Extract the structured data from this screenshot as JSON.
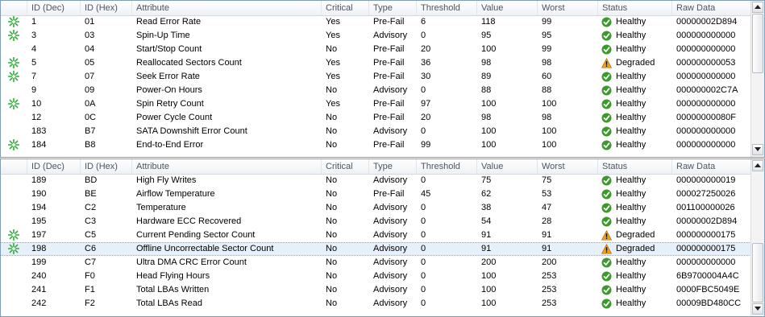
{
  "columns": [
    "",
    "ID (Dec)",
    "ID (Hex)",
    "Attribute",
    "Critical",
    "Type",
    "Threshold",
    "Value",
    "Worst",
    "Status",
    "Raw Data"
  ],
  "colors": {
    "healthy": "#3a9a2a",
    "degraded": "#f0a020",
    "critical_icon": "#2fae3a"
  },
  "top_rows": [
    {
      "crit_icon": true,
      "dec": "1",
      "hex": "01",
      "attr": "Read Error Rate",
      "critical": "Yes",
      "type": "Pre-Fail",
      "threshold": "6",
      "value": "118",
      "worst": "99",
      "status": "Healthy",
      "raw": "00000002D894"
    },
    {
      "crit_icon": true,
      "dec": "3",
      "hex": "03",
      "attr": "Spin-Up Time",
      "critical": "Yes",
      "type": "Advisory",
      "threshold": "0",
      "value": "95",
      "worst": "95",
      "status": "Healthy",
      "raw": "000000000000"
    },
    {
      "crit_icon": false,
      "dec": "4",
      "hex": "04",
      "attr": "Start/Stop Count",
      "critical": "No",
      "type": "Pre-Fail",
      "threshold": "20",
      "value": "100",
      "worst": "99",
      "status": "Healthy",
      "raw": "000000000000"
    },
    {
      "crit_icon": true,
      "dec": "5",
      "hex": "05",
      "attr": "Reallocated Sectors Count",
      "critical": "Yes",
      "type": "Pre-Fail",
      "threshold": "36",
      "value": "98",
      "worst": "98",
      "status": "Degraded",
      "raw": "000000000053"
    },
    {
      "crit_icon": true,
      "dec": "7",
      "hex": "07",
      "attr": "Seek Error Rate",
      "critical": "Yes",
      "type": "Pre-Fail",
      "threshold": "30",
      "value": "89",
      "worst": "60",
      "status": "Healthy",
      "raw": "000000000000"
    },
    {
      "crit_icon": false,
      "dec": "9",
      "hex": "09",
      "attr": "Power-On Hours",
      "critical": "No",
      "type": "Advisory",
      "threshold": "0",
      "value": "88",
      "worst": "88",
      "status": "Healthy",
      "raw": "000000002C7A"
    },
    {
      "crit_icon": true,
      "dec": "10",
      "hex": "0A",
      "attr": "Spin Retry Count",
      "critical": "Yes",
      "type": "Pre-Fail",
      "threshold": "97",
      "value": "100",
      "worst": "100",
      "status": "Healthy",
      "raw": "000000000000"
    },
    {
      "crit_icon": false,
      "dec": "12",
      "hex": "0C",
      "attr": "Power Cycle Count",
      "critical": "No",
      "type": "Pre-Fail",
      "threshold": "20",
      "value": "98",
      "worst": "98",
      "status": "Healthy",
      "raw": "00000000080F"
    },
    {
      "crit_icon": false,
      "dec": "183",
      "hex": "B7",
      "attr": "SATA Downshift Error Count",
      "critical": "No",
      "type": "Advisory",
      "threshold": "0",
      "value": "100",
      "worst": "100",
      "status": "Healthy",
      "raw": "000000000000"
    },
    {
      "crit_icon": true,
      "dec": "184",
      "hex": "B8",
      "attr": "End-to-End Error",
      "critical": "No",
      "type": "Pre-Fail",
      "threshold": "99",
      "value": "100",
      "worst": "100",
      "status": "Healthy",
      "raw": "000000000000"
    }
  ],
  "bottom_rows": [
    {
      "crit_icon": false,
      "dec": "189",
      "hex": "BD",
      "attr": "High Fly Writes",
      "critical": "No",
      "type": "Advisory",
      "threshold": "0",
      "value": "75",
      "worst": "75",
      "status": "Healthy",
      "raw": "000000000019"
    },
    {
      "crit_icon": false,
      "dec": "190",
      "hex": "BE",
      "attr": "Airflow Temperature",
      "critical": "No",
      "type": "Pre-Fail",
      "threshold": "45",
      "value": "62",
      "worst": "53",
      "status": "Healthy",
      "raw": "000027250026"
    },
    {
      "crit_icon": false,
      "dec": "194",
      "hex": "C2",
      "attr": "Temperature",
      "critical": "No",
      "type": "Advisory",
      "threshold": "0",
      "value": "38",
      "worst": "47",
      "status": "Healthy",
      "raw": "001100000026"
    },
    {
      "crit_icon": false,
      "dec": "195",
      "hex": "C3",
      "attr": "Hardware ECC Recovered",
      "critical": "No",
      "type": "Advisory",
      "threshold": "0",
      "value": "54",
      "worst": "28",
      "status": "Healthy",
      "raw": "00000002D894"
    },
    {
      "crit_icon": true,
      "dec": "197",
      "hex": "C5",
      "attr": "Current Pending Sector Count",
      "critical": "No",
      "type": "Advisory",
      "threshold": "0",
      "value": "91",
      "worst": "91",
      "status": "Degraded",
      "raw": "000000000175"
    },
    {
      "crit_icon": true,
      "dec": "198",
      "hex": "C6",
      "attr": "Offline Uncorrectable Sector Count",
      "critical": "No",
      "type": "Advisory",
      "threshold": "0",
      "value": "91",
      "worst": "91",
      "status": "Degraded",
      "raw": "000000000175",
      "selected": true
    },
    {
      "crit_icon": false,
      "dec": "199",
      "hex": "C7",
      "attr": "Ultra DMA CRC Error Count",
      "critical": "No",
      "type": "Advisory",
      "threshold": "0",
      "value": "200",
      "worst": "200",
      "status": "Healthy",
      "raw": "000000000000"
    },
    {
      "crit_icon": false,
      "dec": "240",
      "hex": "F0",
      "attr": "Head Flying Hours",
      "critical": "No",
      "type": "Advisory",
      "threshold": "0",
      "value": "100",
      "worst": "253",
      "status": "Healthy",
      "raw": "6B9700004A4C"
    },
    {
      "crit_icon": false,
      "dec": "241",
      "hex": "F1",
      "attr": "Total LBAs Written",
      "critical": "No",
      "type": "Advisory",
      "threshold": "0",
      "value": "100",
      "worst": "253",
      "status": "Healthy",
      "raw": "0000FBC5049E"
    },
    {
      "crit_icon": false,
      "dec": "242",
      "hex": "F2",
      "attr": "Total LBAs Read",
      "critical": "No",
      "type": "Advisory",
      "threshold": "0",
      "value": "100",
      "worst": "253",
      "status": "Healthy",
      "raw": "00009BD480CC"
    }
  ],
  "icons": {
    "critical": "critical-attribute-icon",
    "healthy": "checkmark-icon",
    "degraded": "warning-icon"
  }
}
